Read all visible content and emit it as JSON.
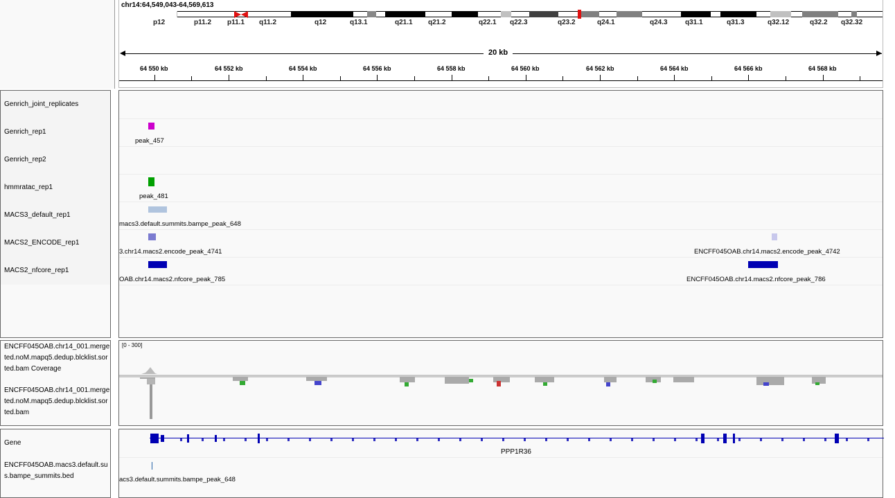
{
  "locus": "chr14:64,549,043-64,569,613",
  "ruler_span": "20 kb",
  "cytobands": [
    {
      "label": "p12",
      "color": "#fff"
    },
    {
      "label": "p11.2",
      "color": "#fff"
    },
    {
      "label": "p11.1",
      "color": "#fff"
    },
    {
      "label": "q11.2",
      "color": "#fff"
    },
    {
      "label": "q12",
      "color": "#000"
    },
    {
      "label": "q13.1",
      "color": "#fff"
    },
    {
      "label": "q21.1",
      "color": "#000"
    },
    {
      "label": "q21.2",
      "color": "#fff"
    },
    {
      "label": "q22.1",
      "color": "#000"
    },
    {
      "label": "q22.3",
      "color": "#fff"
    },
    {
      "label": "q23.2",
      "color": "#fff"
    },
    {
      "label": "q24.1",
      "color": "#808080"
    },
    {
      "label": "q24.3",
      "color": "#fff"
    },
    {
      "label": "q31.1",
      "color": "#000"
    },
    {
      "label": "q31.3",
      "color": "#000"
    },
    {
      "label": "q32.12",
      "color": "#c0c0c0"
    },
    {
      "label": "q32.2",
      "color": "#808080"
    },
    {
      "label": "q32.32",
      "color": "#fff"
    }
  ],
  "ruler_ticks": [
    "64 550 kb",
    "64 552 kb",
    "64 554 kb",
    "64 556 kb",
    "64 558 kb",
    "64 560 kb",
    "64 562 kb",
    "64 564 kb",
    "64 566 kb",
    "64 568 kb"
  ],
  "tracks": [
    {
      "name": "Genrich_joint_replicates"
    },
    {
      "name": "Genrich_rep1",
      "peaks": [
        {
          "label": "peak_457",
          "color": "#cc00cc"
        }
      ]
    },
    {
      "name": "Genrich_rep2"
    },
    {
      "name": "hmmratac_rep1",
      "peaks": [
        {
          "label": "peak_481",
          "color": "#00a000"
        }
      ]
    },
    {
      "name": "MACS3_default_rep1",
      "peaks": [
        {
          "label": "macs3.default.summits.bampe_peak_648",
          "color": "#b0c4de"
        }
      ]
    },
    {
      "name": "MACS2_ENCODE_rep1",
      "peaks": [
        {
          "label": "3.chr14.macs2.encode_peak_4741",
          "color": "#7b7bd0"
        },
        {
          "label": "ENCFF045OAB.chr14.macs2.encode_peak_4742",
          "color": "#c8c8ec"
        }
      ]
    },
    {
      "name": "MACS2_nfcore_rep1",
      "peaks": [
        {
          "label": "OAB.chr14.macs2.nfcore_peak_785",
          "color": "#0000b3"
        },
        {
          "label": "ENCFF045OAB.chr14.macs2.nfcore_peak_786",
          "color": "#0000b3"
        }
      ]
    }
  ],
  "bam": {
    "coverage_name_lines": [
      "ENCFF045OAB.chr14_001.merge",
      "ted.noM.mapq5.dedup.blcklist.sor",
      "ted.bam Coverage"
    ],
    "bam_name_lines": [
      "ENCFF045OAB.chr14_001.merge",
      "ted.noM.mapq5.dedup.blcklist.sor",
      "ted.bam"
    ],
    "range": "[0 - 300]"
  },
  "gene_track": {
    "name": "Gene",
    "gene": "PPP1R36",
    "color": "#0000b3"
  },
  "summit_track": {
    "name_lines": [
      "ENCFF045OAB.macs3.default.su",
      "s.bampe_summits.bed"
    ],
    "label": "acs3.default.summits.bampe_peak_648",
    "color": "#1f5fa6"
  }
}
